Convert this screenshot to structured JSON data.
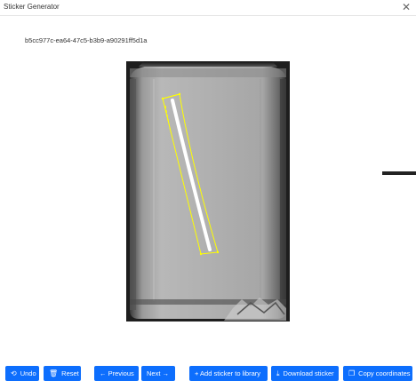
{
  "window": {
    "title": "Sticker Generator",
    "close_icon": "close-icon"
  },
  "image": {
    "id": "b5cc977c-ea64-47c5-b3b9-a90291ff5d1a"
  },
  "toolbar": {
    "undo": {
      "label": "Undo",
      "icon": "⟲"
    },
    "reset": {
      "label": "Reset",
      "icon": "🗑"
    },
    "previous": {
      "label": "← Previous"
    },
    "next": {
      "label": "Next →"
    },
    "add": {
      "label": "+ Add sticker to library"
    },
    "download": {
      "label": "Download sticker",
      "icon": "⤓"
    },
    "copy": {
      "label": "Copy coordinates",
      "icon": "❐"
    }
  },
  "colors": {
    "accent": "#0d6efd",
    "selection": "#ffff00"
  }
}
